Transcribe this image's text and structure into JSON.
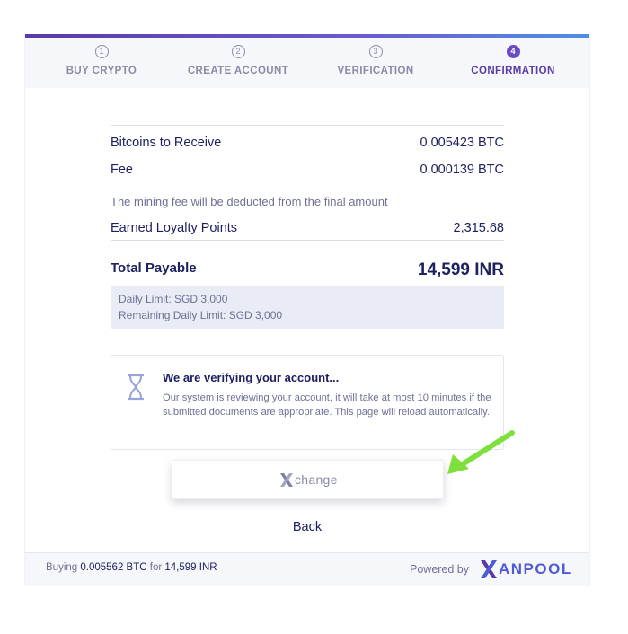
{
  "steps": [
    {
      "num": "1",
      "label": "BUY CRYPTO"
    },
    {
      "num": "2",
      "label": "CREATE ACCOUNT"
    },
    {
      "num": "3",
      "label": "VERIFICATION"
    },
    {
      "num": "4",
      "label": "CONFIRMATION"
    }
  ],
  "active_step": 4,
  "summary": {
    "bitcoins_label": "Bitcoins to Receive",
    "bitcoins_value": "0.005423 BTC",
    "fee_label": "Fee",
    "fee_value": "0.000139 BTC",
    "fee_note": "The mining fee will be deducted from the final amount",
    "loyalty_label": "Earned Loyalty Points",
    "loyalty_value": "2,315.68",
    "total_label": "Total Payable",
    "total_value": "14,599 INR",
    "daily_limit": "Daily Limit: SGD 3,000",
    "remaining_limit": "Remaining Daily Limit: SGD 3,000"
  },
  "verification": {
    "icon": "hourglass-icon",
    "title": "We are verifying your account...",
    "text": "Our system is reviewing your account, it will take at most 10 minutes if the submitted documents are appropriate. This page will reload automatically."
  },
  "xchange_button": {
    "label": "change"
  },
  "back_label": "Back",
  "footer": {
    "buying_prefix": "Buying",
    "buying_amount": "0.005562 BTC",
    "buying_for": "for",
    "buying_total": "14,599 INR",
    "powered_by": "Powered by",
    "brand": "ANPOOL"
  },
  "colors": {
    "accent": "#5b3aa8",
    "text_dark": "#1d2160",
    "text_muted": "#6d7195",
    "brand_blue": "#4f5bd5",
    "arrow_green": "#7ee03a"
  }
}
